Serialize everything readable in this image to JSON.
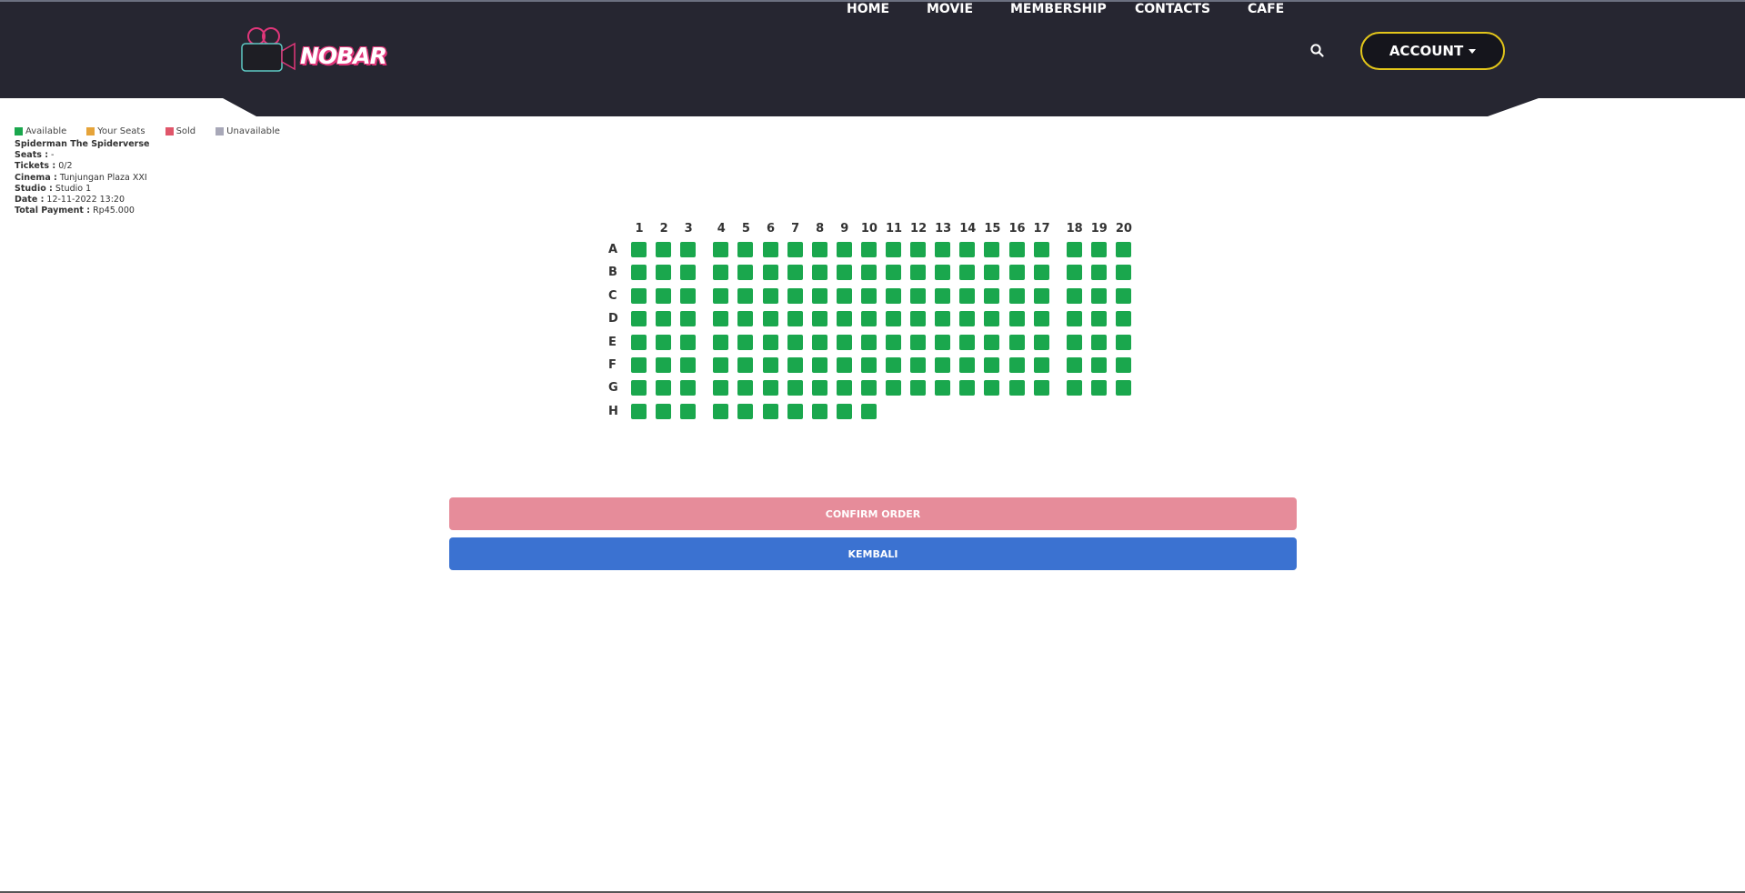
{
  "header": {
    "logo_text": "NOBAR",
    "nav": [
      "HOME",
      "MOVIE",
      "MEMBERSHIP",
      "CONTACTS",
      "CAFE"
    ],
    "account_label": "ACCOUNT",
    "colors": {
      "background": "#262631",
      "account_border": "#e3c61a"
    }
  },
  "legend": [
    {
      "label": "Available",
      "color": "#1aa74d"
    },
    {
      "label": "Your Seats",
      "color": "#e6a43a"
    },
    {
      "label": "Sold",
      "color": "#e0566a"
    },
    {
      "label": "Unavailable",
      "color": "#a8a8b8"
    }
  ],
  "booking": {
    "movie": "Spiderman The Spiderverse",
    "seats_label": "Seats :",
    "seats_value": " -",
    "tickets_label": "Tickets :",
    "tickets_value": " 0/2",
    "cinema_label": "Cinema :",
    "cinema_value": " Tunjungan Plaza XXI",
    "studio_label": "Studio :",
    "studio_value": " Studio 1",
    "date_label": "Date :",
    "date_value": " 12-11-2022 13:20",
    "payment_label": "Total Payment :",
    "payment_value": " Rp45.000"
  },
  "seatmap": {
    "columns": [
      "1",
      "2",
      "3",
      "4",
      "5",
      "6",
      "7",
      "8",
      "9",
      "10",
      "11",
      "12",
      "13",
      "14",
      "15",
      "16",
      "17",
      "18",
      "19",
      "20"
    ],
    "rows": [
      {
        "label": "A",
        "seats": 20,
        "status": "available"
      },
      {
        "label": "B",
        "seats": 20,
        "status": "available"
      },
      {
        "label": "C",
        "seats": 20,
        "status": "available"
      },
      {
        "label": "D",
        "seats": 20,
        "status": "available"
      },
      {
        "label": "E",
        "seats": 20,
        "status": "available"
      },
      {
        "label": "F",
        "seats": 20,
        "status": "available"
      },
      {
        "label": "G",
        "seats": 20,
        "status": "available"
      },
      {
        "label": "H",
        "seats": 10,
        "status": "available"
      }
    ]
  },
  "actions": {
    "confirm_label": "CONFIRM ORDER",
    "back_label": "KEMBALI"
  }
}
